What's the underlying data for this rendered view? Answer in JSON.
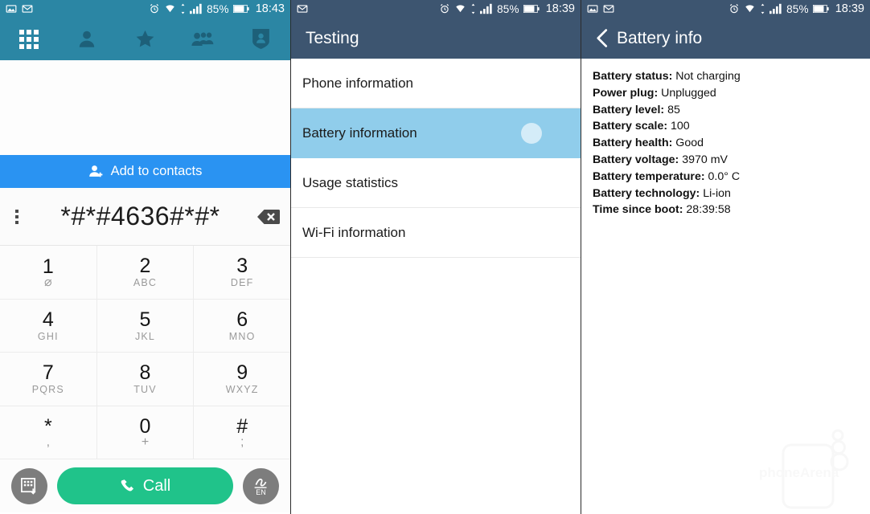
{
  "colors": {
    "teal": "#2b86a4",
    "slate": "#3d5570",
    "blue_action": "#2a93f2",
    "call_green": "#20c38a",
    "row_selected": "#90cdeb"
  },
  "status_bar": {
    "left_icons": [
      "image-icon",
      "gmail-icon"
    ],
    "mid_icons": [
      "alarm-icon",
      "wifi-icon",
      "data-transfer-icon",
      "signal-icon"
    ],
    "battery_percent": "85%",
    "battery_icon": "battery-icon",
    "time_left": "18:43",
    "time_mid": "18:39",
    "time_right": "18:39"
  },
  "dialer": {
    "tabs": [
      {
        "name": "keypad-tab",
        "icon": "keypad-icon",
        "active": true
      },
      {
        "name": "contacts-tab",
        "icon": "person-icon",
        "active": false
      },
      {
        "name": "favorites-tab",
        "icon": "star-icon",
        "active": false
      },
      {
        "name": "groups-tab",
        "icon": "groups-icon",
        "active": false
      },
      {
        "name": "profile-tab",
        "icon": "contact-badge-icon",
        "active": false
      }
    ],
    "add_to_contacts_label": "Add to contacts",
    "add_to_contacts_icon": "add-person-icon",
    "overflow_icon": "overflow-menu-icon",
    "dialed_number": "*#*#4636#*#*",
    "backspace_icon": "backspace-icon",
    "keys": [
      {
        "digit": "1",
        "sub": "⌀",
        "sub_is_symbol": true
      },
      {
        "digit": "2",
        "sub": "ABC",
        "sub_is_symbol": false
      },
      {
        "digit": "3",
        "sub": "DEF",
        "sub_is_symbol": false
      },
      {
        "digit": "4",
        "sub": "GHI",
        "sub_is_symbol": false
      },
      {
        "digit": "5",
        "sub": "JKL",
        "sub_is_symbol": false
      },
      {
        "digit": "6",
        "sub": "MNO",
        "sub_is_symbol": false
      },
      {
        "digit": "7",
        "sub": "PQRS",
        "sub_is_symbol": false
      },
      {
        "digit": "8",
        "sub": "TUV",
        "sub_is_symbol": false
      },
      {
        "digit": "9",
        "sub": "WXYZ",
        "sub_is_symbol": false
      },
      {
        "digit": "*",
        "sub": ",",
        "sub_is_symbol": true
      },
      {
        "digit": "0",
        "sub": "+",
        "sub_is_symbol": true
      },
      {
        "digit": "#",
        "sub": ";",
        "sub_is_symbol": true
      }
    ],
    "keypad_toggle_icon": "keypad-hide-icon",
    "call_label": "Call",
    "call_icon": "phone-icon",
    "ime_label": "EN",
    "ime_icon": "handwriting-icon"
  },
  "testing": {
    "title": "Testing",
    "items": [
      {
        "label": "Phone information",
        "selected": false
      },
      {
        "label": "Battery information",
        "selected": true
      },
      {
        "label": "Usage statistics",
        "selected": false
      },
      {
        "label": "Wi-Fi information",
        "selected": false
      }
    ]
  },
  "battery_info": {
    "title": "Battery info",
    "back_icon": "back-chevron-icon",
    "rows": [
      {
        "label": "Battery status:",
        "value": "Not charging"
      },
      {
        "label": "Power plug:",
        "value": "Unplugged"
      },
      {
        "label": "Battery level:",
        "value": "85"
      },
      {
        "label": "Battery scale:",
        "value": "100"
      },
      {
        "label": "Battery health:",
        "value": "Good"
      },
      {
        "label": "Battery voltage:",
        "value": "3970 mV"
      },
      {
        "label": "Battery temperature:",
        "value": "0.0° C"
      },
      {
        "label": "Battery technology:",
        "value": "Li-ion"
      },
      {
        "label": "Time since boot:",
        "value": "28:39:58"
      }
    ],
    "watermark": "phoneArena"
  }
}
